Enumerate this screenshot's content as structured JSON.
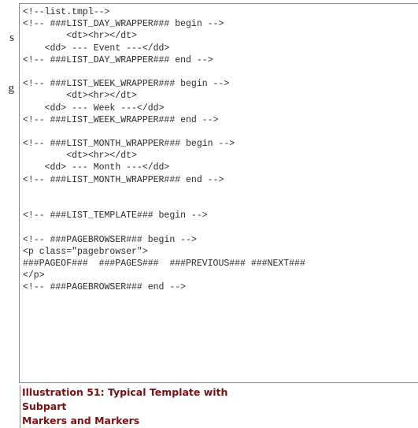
{
  "left_fragments": [
    "s",
    "g"
  ],
  "code_lines": [
    "<!--list.tmpl-->",
    "<!-- ###LIST_DAY_WRAPPER### begin -->",
    "        <dt><hr></dt>",
    "    <dd> --- Event ---</dd>",
    "<!-- ###LIST_DAY_WRAPPER### end -->",
    "",
    "<!-- ###LIST_WEEK_WRAPPER### begin -->",
    "        <dt><hr></dt>",
    "    <dd> --- Week ---</dd>",
    "<!-- ###LIST_WEEK_WRAPPER### end -->",
    "",
    "<!-- ###LIST_MONTH_WRAPPER### begin -->",
    "        <dt><hr></dt>",
    "    <dd> --- Month ---</dd>",
    "<!-- ###LIST_MONTH_WRAPPER### end -->",
    "",
    "",
    "<!-- ###LIST_TEMPLATE### begin -->",
    "",
    "<!-- ###PAGEBROWSER### begin -->",
    "<p class=\"pagebrowser\">",
    "###PAGEOF###  ###PAGES###  ###PREVIOUS### ###NEXT###",
    "</p>",
    "<!-- ###PAGEBROWSER### end -->"
  ],
  "caption": {
    "line1": "Illustration 51: Typical Template with Subpart",
    "line2": "Markers and Markers"
  }
}
